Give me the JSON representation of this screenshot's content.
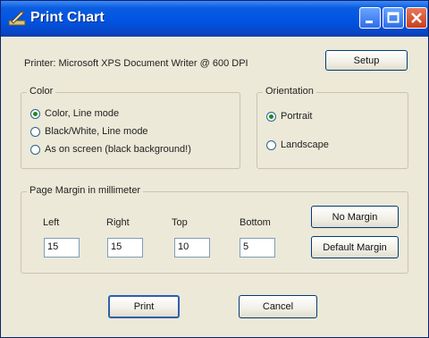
{
  "window": {
    "title": "Print Chart"
  },
  "printer": {
    "text": "Printer: Microsoft XPS Document Writer @ 600 DPI",
    "setup_label": "Setup"
  },
  "color_group": {
    "legend": "Color",
    "options": [
      {
        "label": "Color, Line mode",
        "selected": true
      },
      {
        "label": "Black/White, Line mode",
        "selected": false
      },
      {
        "label": "As on screen (black background!)",
        "selected": false
      }
    ]
  },
  "orientation_group": {
    "legend": "Orientation",
    "options": [
      {
        "label": "Portrait",
        "selected": true
      },
      {
        "label": "Landscape",
        "selected": false
      }
    ]
  },
  "margin_group": {
    "legend": "Page Margin in millimeter",
    "fields": [
      {
        "label": "Left",
        "value": "15"
      },
      {
        "label": "Right",
        "value": "15"
      },
      {
        "label": "Top",
        "value": "10"
      },
      {
        "label": "Bottom",
        "value": "5"
      }
    ],
    "no_margin_label": "No Margin",
    "default_margin_label": "Default Margin"
  },
  "footer": {
    "print_label": "Print",
    "cancel_label": "Cancel"
  }
}
